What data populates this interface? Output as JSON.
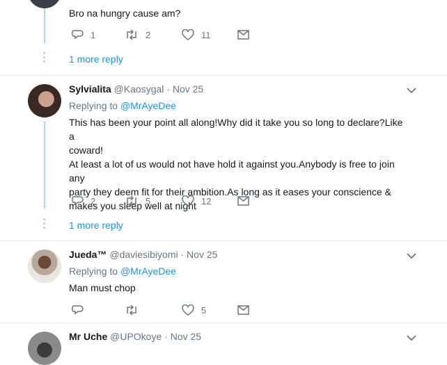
{
  "tweets": [
    {
      "text": "Bro na hungry cause am?",
      "reply": "1",
      "retweet": "2",
      "like": "11",
      "more_reply": "1 more reply"
    },
    {
      "name": "Sylvialita",
      "handle": "@Kaosygal",
      "date": "· Nov 25",
      "replying_prefix": "Replying to",
      "replying_to": "@MrAyeDee",
      "text_line1": "This has been your point all along!Why did it take you so long to declare?Like a",
      "text_line2": "coward!",
      "text_line3": "At least a lot of us would not have hold it against you.Anybody is free to join any",
      "text_line4": "party they deem fit for their ambition.As long as it eases your conscience &",
      "text_line5": "makes you sleep well at night",
      "reply": "2",
      "retweet": "5",
      "like": "12",
      "more_reply": "1 more reply"
    },
    {
      "name": "Jueda™",
      "handle": "@daviesibiyomi",
      "date": "· Nov 25",
      "replying_prefix": "Replying to",
      "replying_to": "@MrAyeDee",
      "text": "Man must chop",
      "like": "5"
    },
    {
      "name": "Mr Uche",
      "handle": "@UPOkoye",
      "date": "· Nov 25"
    }
  ],
  "icons": {
    "reply": "reply-icon",
    "retweet": "retweet-icon",
    "like": "heart-icon",
    "dm": "envelope-icon",
    "more": "chevron-down-icon"
  },
  "colors": {
    "link": "#1b95e0",
    "muted": "#657786",
    "thread": "#a8d5ea",
    "divider": "#e6ecf0"
  }
}
